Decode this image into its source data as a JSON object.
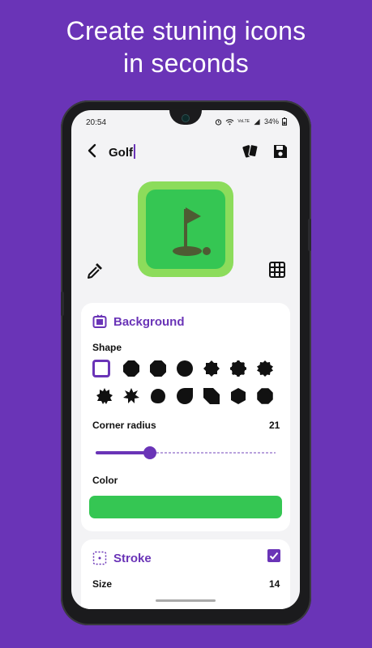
{
  "headline": {
    "line1": "Create stuning icons",
    "line2": "in seconds"
  },
  "status": {
    "time": "20:54",
    "signal": "VoLTE",
    "battery": "34%"
  },
  "appbar": {
    "title": "Golf"
  },
  "background_section": {
    "title": "Background",
    "shape_label": "Shape",
    "corner_radius_label": "Corner radius",
    "corner_radius_value": "21",
    "corner_radius_fraction": 0.3,
    "color_label": "Color",
    "color_value": "#35c653"
  },
  "stroke_section": {
    "title": "Stroke",
    "enabled": true,
    "size_label": "Size",
    "size_value": "14"
  },
  "colors": {
    "accent": "#6a34b7",
    "icon_outer": "#8cdc5b",
    "icon_inner": "#35c653",
    "glyph": "#4e5b33"
  },
  "shapes_row1": [
    "square-selected",
    "octagon",
    "rounded-octagon",
    "circle",
    "star-8",
    "scalloped-circle",
    "wavy-circle"
  ],
  "shapes_row2": [
    "burst",
    "star-sharp",
    "blob",
    "teardrop",
    "cut-square",
    "hexagon",
    "rounded-octagon-2"
  ]
}
